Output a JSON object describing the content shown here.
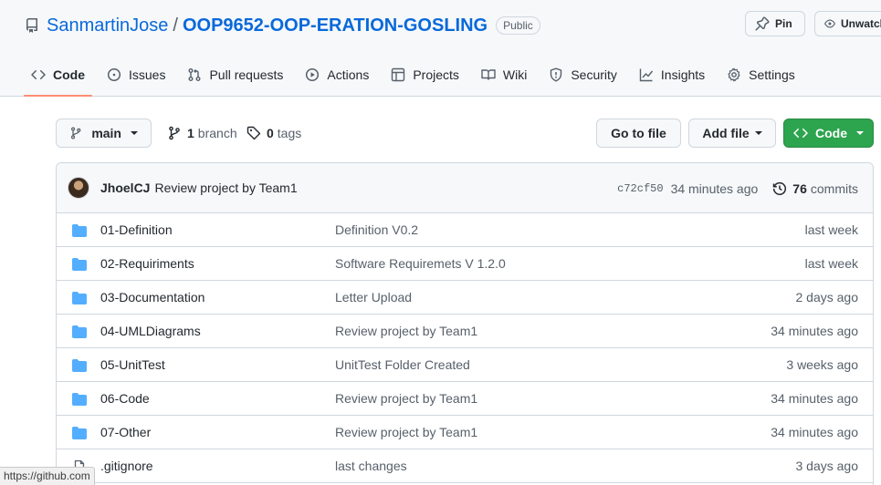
{
  "repo": {
    "owner": "SanmartinJose",
    "separator": "/",
    "name": "OOP9652-OOP-ERATION-GOSLING",
    "visibility": "Public"
  },
  "header_buttons": {
    "pin": "Pin",
    "watch": "Unwatch"
  },
  "tabs": [
    {
      "label": "Code",
      "icon": "code-icon",
      "active": true
    },
    {
      "label": "Issues",
      "icon": "issue-icon"
    },
    {
      "label": "Pull requests",
      "icon": "pull-request-icon"
    },
    {
      "label": "Actions",
      "icon": "play-icon"
    },
    {
      "label": "Projects",
      "icon": "table-icon"
    },
    {
      "label": "Wiki",
      "icon": "book-icon"
    },
    {
      "label": "Security",
      "icon": "shield-icon"
    },
    {
      "label": "Insights",
      "icon": "graph-icon"
    },
    {
      "label": "Settings",
      "icon": "gear-icon"
    }
  ],
  "toolbar": {
    "branch": "main",
    "branch_count": "1",
    "branch_label": "branch",
    "tag_count": "0",
    "tag_label": "tags",
    "go_to_file": "Go to file",
    "add_file": "Add file",
    "code": "Code"
  },
  "latest_commit": {
    "author": "JhoelCJ",
    "message": "Review project by Team1",
    "sha": "c72cf50",
    "time": "34 minutes ago",
    "commit_count": "76",
    "commit_label": "commits"
  },
  "files": [
    {
      "type": "dir",
      "name": "01-Definition",
      "message": "Definition V0.2",
      "date": "last week"
    },
    {
      "type": "dir",
      "name": "02-Requiriments",
      "message": "Software Requiremets V 1.2.0",
      "date": "last week"
    },
    {
      "type": "dir",
      "name": "03-Documentation",
      "message": "Letter Upload",
      "date": "2 days ago"
    },
    {
      "type": "dir",
      "name": "04-UMLDiagrams",
      "message": "Review project by Team1",
      "date": "34 minutes ago"
    },
    {
      "type": "dir",
      "name": "05-UnitTest",
      "message": "UnitTest Folder Created",
      "date": "3 weeks ago"
    },
    {
      "type": "dir",
      "name": "06-Code",
      "message": "Review project by Team1",
      "date": "34 minutes ago"
    },
    {
      "type": "dir",
      "name": "07-Other",
      "message": "Review project by Team1",
      "date": "34 minutes ago"
    },
    {
      "type": "file",
      "name": ".gitignore",
      "message": "last changes",
      "date": "3 days ago"
    }
  ],
  "status_bar": "https://github.com",
  "colors": {
    "link": "#0969da",
    "primary_button": "#2da44e",
    "folder": "#54aeff",
    "active_tab_underline": "#fd8c73"
  }
}
